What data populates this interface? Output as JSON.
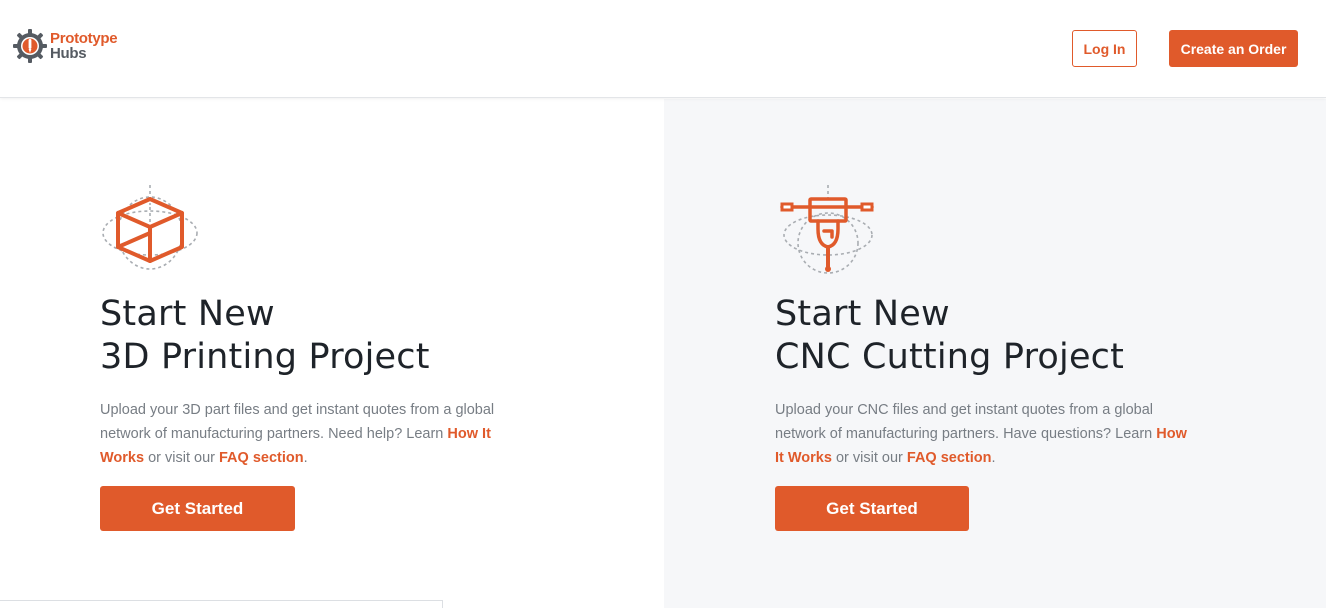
{
  "header": {
    "logo": {
      "line1": "Prototype",
      "line2": "Hubs",
      "icon": "gear-logo-icon"
    },
    "login_label": "Log In",
    "create_order_label": "Create an Order"
  },
  "cards": [
    {
      "icon": "3d-cube-icon",
      "title_line1": "Start New",
      "title_line2": "3D Printing Project",
      "desc_text": "Upload your 3D part files and get instant quotes from a global network of manufacturing partners. Need help? Learn ",
      "link1": "How It Works",
      "middle_text": " or visit our ",
      "link2": "FAQ section",
      "end_text": ".",
      "button_label": "Get Started"
    },
    {
      "icon": "cnc-mill-icon",
      "title_line1": "Start New",
      "title_line2": "CNC Cutting Project",
      "desc_text": "Upload your CNC files and get instant quotes from a global network of manufacturing partners. Have questions? Learn ",
      "link1": "How It Works",
      "middle_text": " or visit our ",
      "link2": "FAQ section",
      "end_text": ".",
      "button_label": "Get Started"
    }
  ],
  "colors": {
    "accent": "#e05a2b",
    "heading": "#1e2329",
    "body_text": "#777d84",
    "right_panel_bg": "#f6f7f9"
  }
}
